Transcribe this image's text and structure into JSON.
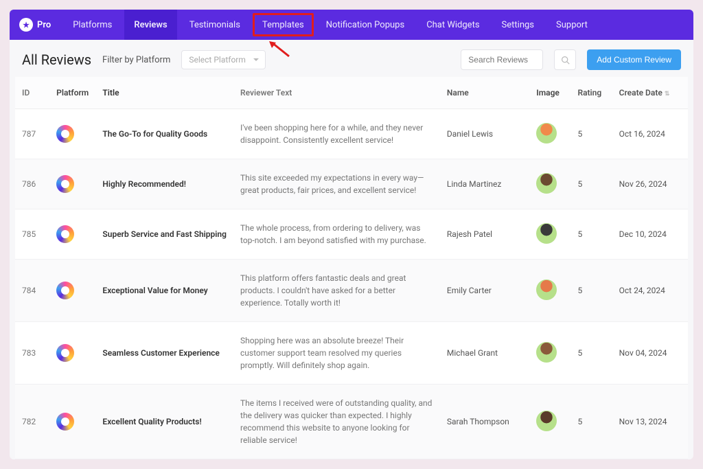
{
  "brand": {
    "name": "Pro"
  },
  "nav": {
    "items": [
      {
        "label": "Platforms",
        "state": ""
      },
      {
        "label": "Reviews",
        "state": "active"
      },
      {
        "label": "Testimonials",
        "state": ""
      },
      {
        "label": "Templates",
        "state": "highlight"
      },
      {
        "label": "Notification Popups",
        "state": ""
      },
      {
        "label": "Chat Widgets",
        "state": ""
      },
      {
        "label": "Settings",
        "state": ""
      },
      {
        "label": "Support",
        "state": ""
      }
    ]
  },
  "page": {
    "title": "All Reviews",
    "filter_label": "Filter by Platform",
    "select_placeholder": "Select Platform",
    "search_placeholder": "Search Reviews",
    "add_button": "Add Custom Review"
  },
  "columns": {
    "id": "ID",
    "platform": "Platform",
    "title": "Title",
    "text": "Reviewer Text",
    "name": "Name",
    "image": "Image",
    "rating": "Rating",
    "date": "Create Date"
  },
  "rows": [
    {
      "id": "787",
      "title": "The Go-To for Quality Goods",
      "text": "I've been shopping here for a while, and they never disappoint. Consistently excellent service!",
      "name": "Daniel Lewis",
      "rating": "5",
      "date": "Oct 16, 2024",
      "avatar": "#f08a4a"
    },
    {
      "id": "786",
      "title": "Highly Recommended!",
      "text": "This site exceeded my expectations in every way—great products, fair prices, and excellent service!",
      "name": "Linda Martinez",
      "rating": "5",
      "date": "Nov 26, 2024",
      "avatar": "#6b4a30"
    },
    {
      "id": "785",
      "title": "Superb Service and Fast Shipping",
      "text": "The whole process, from ordering to delivery, was top-notch. I am beyond satisfied with my purchase.",
      "name": "Rajesh Patel",
      "rating": "5",
      "date": "Dec 10, 2024",
      "avatar": "#3a3a3a"
    },
    {
      "id": "784",
      "title": "Exceptional Value for Money",
      "text": "This platform offers fantastic deals and great products. I couldn't have asked for a better experience. Totally worth it!",
      "name": "Emily Carter",
      "rating": "5",
      "date": "Oct 24, 2024",
      "avatar": "#e57a4a"
    },
    {
      "id": "783",
      "title": "Seamless Customer Experience",
      "text": "Shopping here was an absolute breeze! Their customer support team resolved my queries promptly. Will definitely shop again.",
      "name": "Michael Grant",
      "rating": "5",
      "date": "Nov 04, 2024",
      "avatar": "#8a5a3a"
    },
    {
      "id": "782",
      "title": "Excellent Quality Products!",
      "text": "The items I received were of outstanding quality, and the delivery was quicker than expected. I highly recommend this website to anyone looking for reliable service!",
      "name": "Sarah Thompson",
      "rating": "5",
      "date": "Nov 13, 2024",
      "avatar": "#5a3a2a"
    }
  ]
}
